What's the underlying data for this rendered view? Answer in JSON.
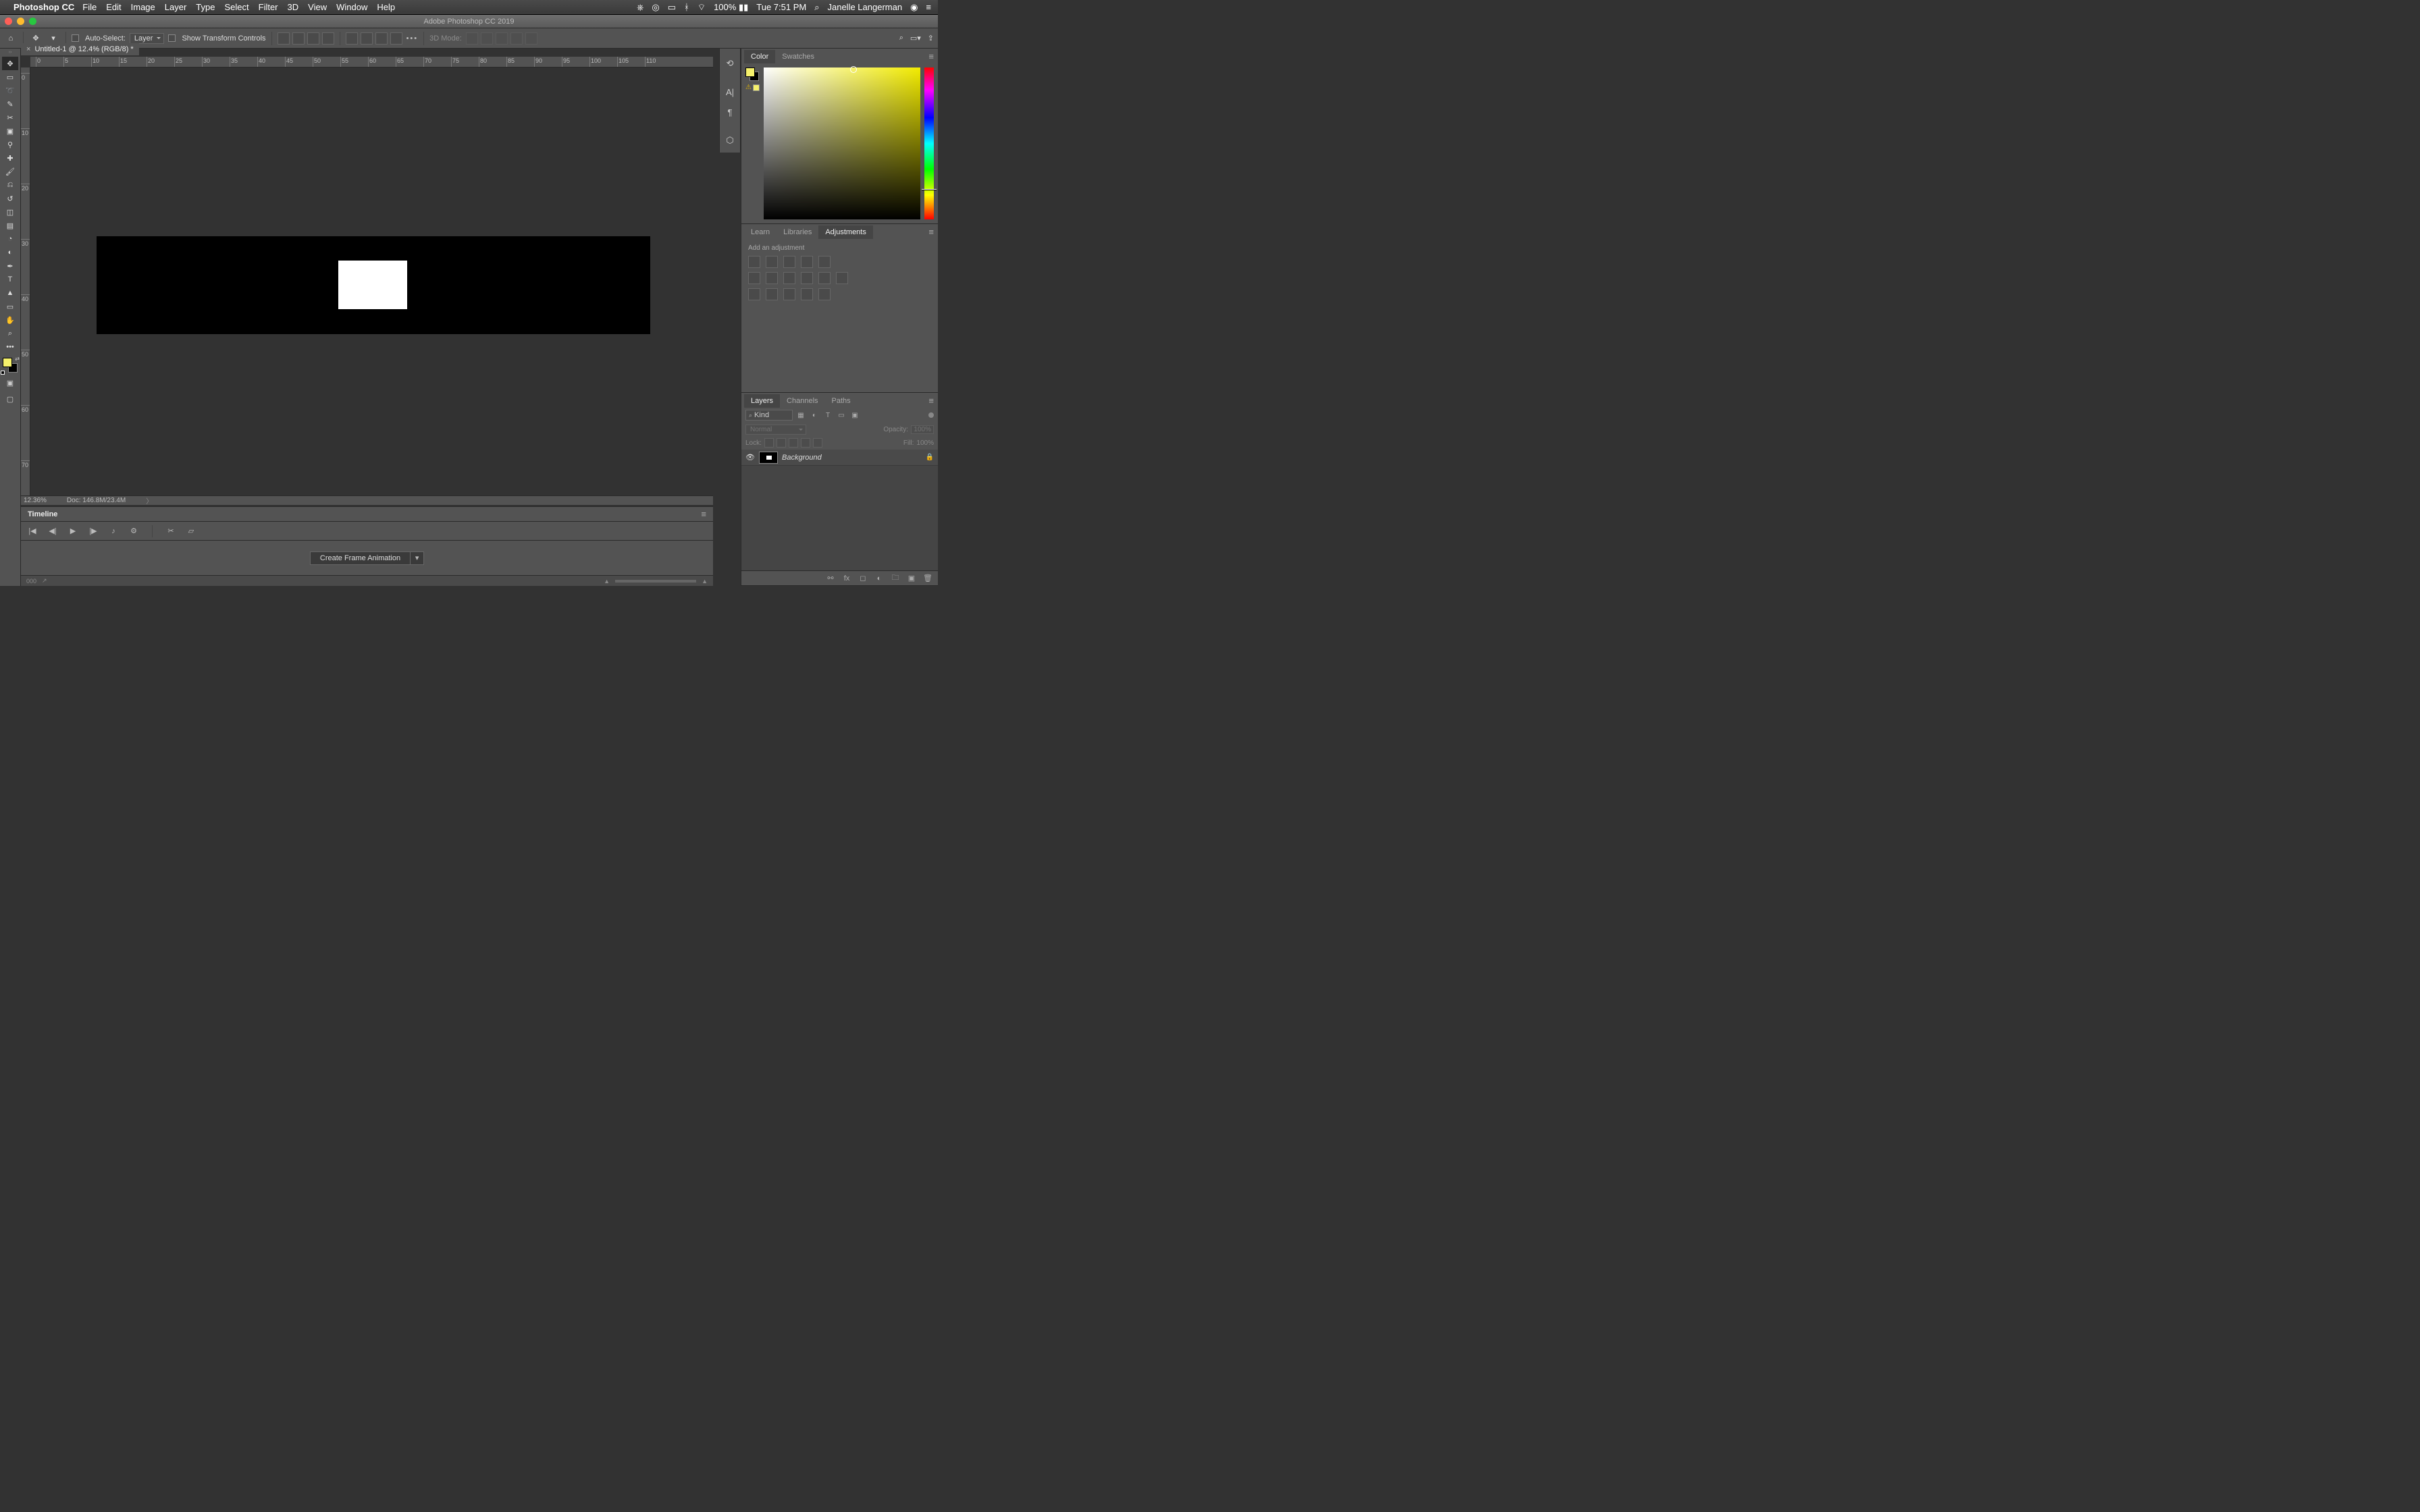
{
  "menubar": {
    "apple": "",
    "app": "Photoshop CC",
    "items": [
      "File",
      "Edit",
      "Image",
      "Layer",
      "Type",
      "Select",
      "Filter",
      "3D",
      "View",
      "Window",
      "Help"
    ],
    "battery": "100%",
    "clock": "Tue 7:51 PM",
    "user": "Janelle Langerman"
  },
  "titlebar": {
    "title": "Adobe Photoshop CC 2019"
  },
  "optbar": {
    "auto_select_label": "Auto-Select:",
    "layer_target": "Layer",
    "show_transform": "Show Transform Controls",
    "mode3d_label": "3D Mode:"
  },
  "doc_tab": {
    "title": "Untitled-1 @ 12.4% (RGB/8) *"
  },
  "ruler_h": [
    "0",
    "5",
    "10",
    "15",
    "20",
    "25",
    "30",
    "35",
    "40",
    "45",
    "50",
    "55",
    "60",
    "65",
    "70",
    "75",
    "80",
    "85",
    "90",
    "95",
    "100",
    "105",
    "110"
  ],
  "ruler_v": [
    "0",
    "10",
    "20",
    "30",
    "40",
    "50",
    "60",
    "70"
  ],
  "status": {
    "zoom": "12.36%",
    "doc": "Doc: 146.8M/23.4M"
  },
  "timeline": {
    "tab": "Timeline",
    "create_btn": "Create Frame Animation"
  },
  "ministrip": {
    "history": "history-icon",
    "char": "A|",
    "para": "¶",
    "cube": "cube-icon"
  },
  "color_panel": {
    "tabs": [
      "Color",
      "Swatches"
    ]
  },
  "adj_panel": {
    "tabs": [
      "Learn",
      "Libraries",
      "Adjustments"
    ],
    "hint": "Add an adjustment"
  },
  "layers_panel": {
    "tabs": [
      "Layers",
      "Channels",
      "Paths"
    ],
    "kind_placeholder": "Kind",
    "blend_mode": "Normal",
    "opacity_label": "Opacity:",
    "opacity_val": "100%",
    "lock_label": "Lock:",
    "fill_label": "Fill:",
    "fill_val": "100%",
    "layer0_name": "Background"
  },
  "colors": {
    "fg": "#f5f16c",
    "bg": "#000000"
  }
}
